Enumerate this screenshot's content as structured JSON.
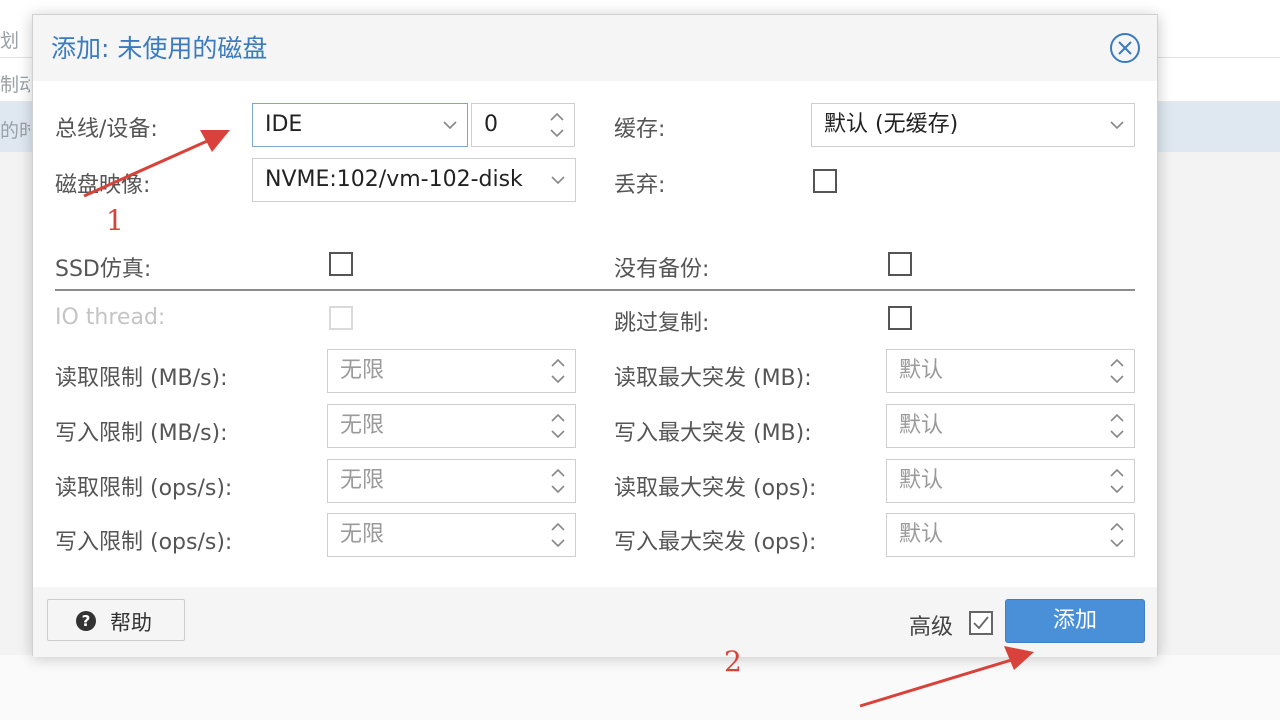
{
  "background": {
    "left_text_1": "划",
    "left_text_2": "制动",
    "left_text_3": "的时"
  },
  "dialog": {
    "title": "添加: 未使用的磁盘"
  },
  "form": {
    "bus_label": "总线/设备:",
    "bus_value": "IDE",
    "device_number": "0",
    "cache_label": "缓存:",
    "cache_value": "默认 (无缓存)",
    "disk_image_label": "磁盘映像:",
    "disk_image_value": "NVME:102/vm-102-disk",
    "discard_label": "丢弃:",
    "ssd_label": "SSD仿真:",
    "no_backup_label": "没有备份:",
    "io_thread_label": "IO thread:",
    "skip_replication_label": "跳过复制:",
    "read_limit_mb_label": "读取限制 (MB/s):",
    "read_limit_mb_value": "无限",
    "read_burst_mb_label": "读取最大突发 (MB):",
    "read_burst_mb_value": "默认",
    "write_limit_mb_label": "写入限制 (MB/s):",
    "write_limit_mb_value": "无限",
    "write_burst_mb_label": "写入最大突发 (MB):",
    "write_burst_mb_value": "默认",
    "read_limit_ops_label": "读取限制 (ops/s):",
    "read_limit_ops_value": "无限",
    "read_burst_ops_label": "读取最大突发 (ops):",
    "read_burst_ops_value": "默认",
    "write_limit_ops_label": "写入限制 (ops/s):",
    "write_limit_ops_value": "无限",
    "write_burst_ops_label": "写入最大突发 (ops):",
    "write_burst_ops_value": "默认"
  },
  "footer": {
    "help_label": "帮助",
    "advanced_label": "高级",
    "advanced_checked": true,
    "add_label": "添加"
  },
  "annotations": {
    "marker_1": "1",
    "marker_2": "2",
    "color": "#d9423a"
  },
  "colors": {
    "accent": "#3a7bbf",
    "primary_button": "#4a90d9"
  }
}
